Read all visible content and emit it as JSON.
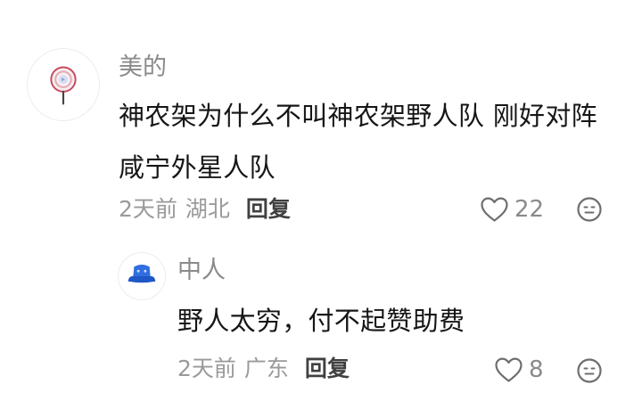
{
  "comment": {
    "author": "美的",
    "text": "神农架为什么不叫神农架野人队 刚好对阵 咸宁外星人队",
    "time": "2天前",
    "location": "湖北",
    "reply_label": "回复",
    "likes": "22",
    "avatar_icon": "lollipop-icon",
    "reply": {
      "author": "中人",
      "text": "野人太穷，付不起赞助费",
      "time": "2天前",
      "location": "广东",
      "reply_label": "回复",
      "likes": "8",
      "avatar_icon": "bucket-hat-icon"
    }
  },
  "colors": {
    "meta_text": "#9a9a9a",
    "name_text": "#8a8a8a",
    "body_text": "#161616",
    "hat_blue": "#2f6fe0"
  }
}
